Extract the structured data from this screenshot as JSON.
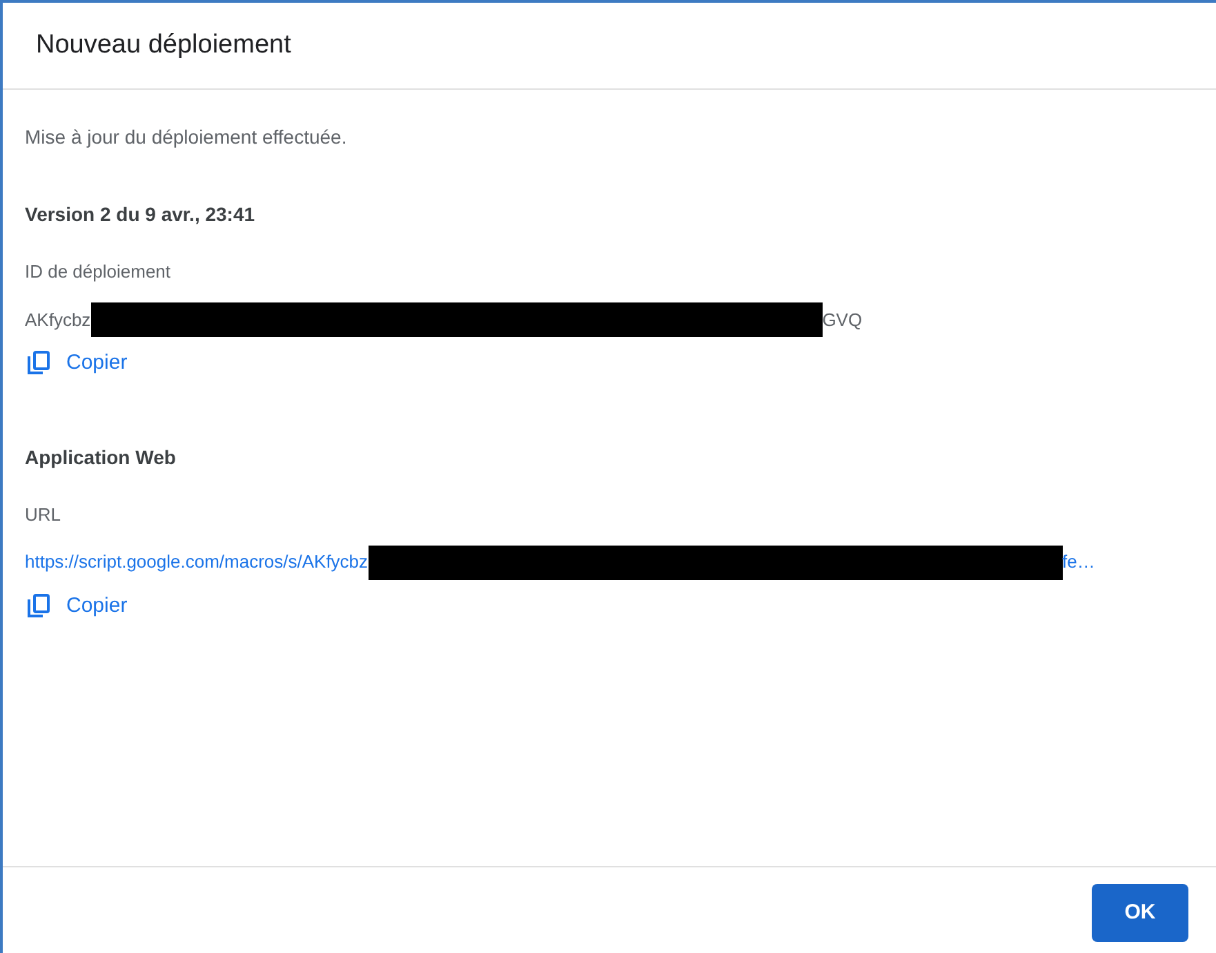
{
  "dialog": {
    "title": "Nouveau déploiement"
  },
  "message": "Mise à jour du déploiement effectuée.",
  "sections": [
    {
      "kind": "id",
      "heading": "Version 2 du 9 avr., 23:41",
      "label": "ID de déploiement",
      "value_start": "AKfycbz",
      "value_end": "GVQ",
      "copy_label": "Copier"
    },
    {
      "kind": "url",
      "heading": "Application Web",
      "label": "URL",
      "value_start": "https://script.google.com/macros/s/AKfycbz",
      "value_end": "fe…",
      "copy_label": "Copier"
    }
  ],
  "buttons": [
    "OK"
  ]
}
